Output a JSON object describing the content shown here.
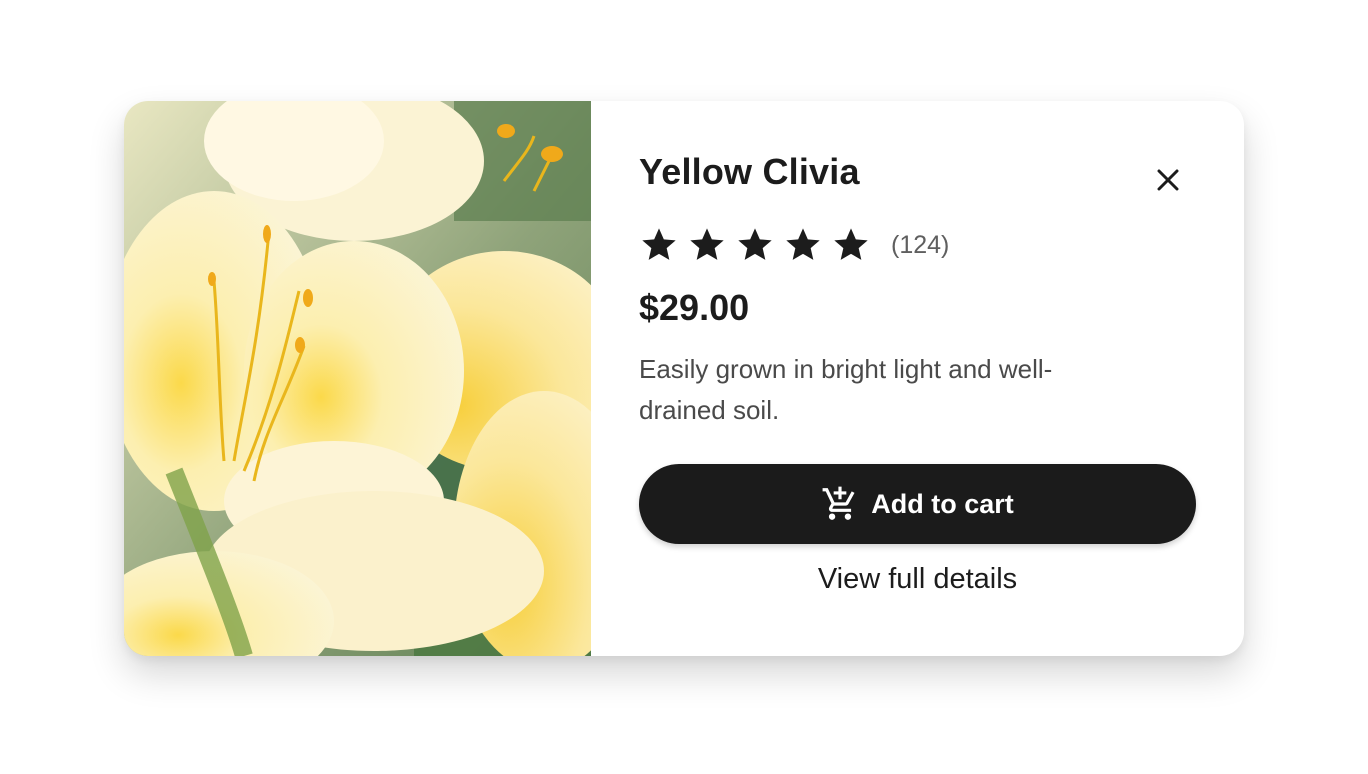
{
  "product": {
    "image_alt": "Yellow Clivia flowers",
    "title": "Yellow Clivia",
    "rating": 5,
    "rating_max": 5,
    "review_count": "(124)",
    "price": "$29.00",
    "description": "Easily grown in bright light and well-drained soil."
  },
  "actions": {
    "close_icon": "close-icon",
    "add_to_cart_label": "Add to cart",
    "add_to_cart_icon": "cart-add-icon",
    "view_details_label": "View full details"
  },
  "colors": {
    "button_bg": "#1b1b1b",
    "text_primary": "#1c1c1c",
    "text_secondary": "#4a4a4a",
    "star": "#1c1c1c"
  }
}
